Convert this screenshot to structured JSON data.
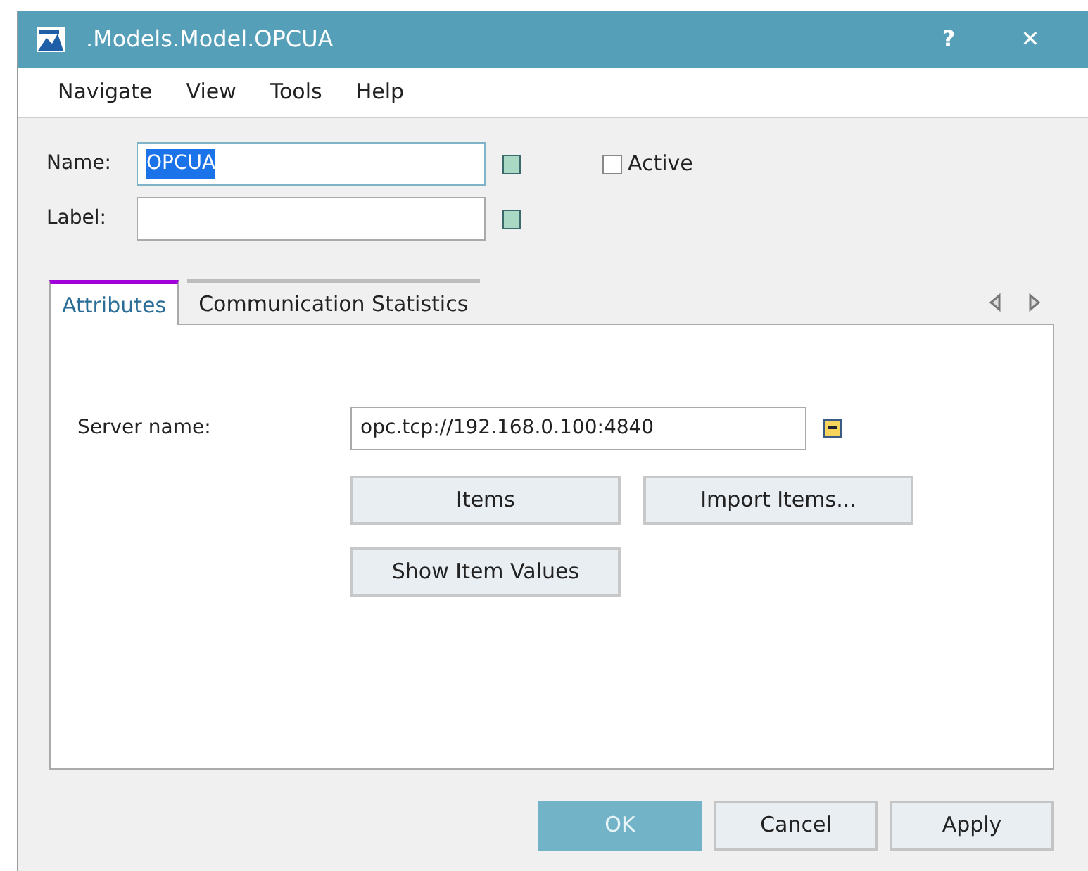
{
  "window": {
    "title": ".Models.Model.OPCUA",
    "controls": [
      "?",
      "✕"
    ]
  },
  "menu": [
    "Navigate",
    "View",
    "Tools",
    "Help"
  ],
  "fields": [
    {
      "label": "Name:",
      "value": "OPCUA",
      "text_selected": true
    },
    {
      "label": "Label:",
      "text_selected": false
    }
  ],
  "active": {
    "label": "Active",
    "checked": false
  },
  "tabs": [
    {
      "label": "Attributes",
      "selected": true
    },
    {
      "label": "Communication Statistics",
      "selected": false
    }
  ],
  "server": {
    "label": "Server name:",
    "value": "opc.tcp://192.168.0.100:4840"
  },
  "panel_buttons": [
    [
      "Items",
      "Import Items..."
    ],
    [
      "Show Item Values"
    ]
  ],
  "footer_buttons": [
    {
      "label": "OK",
      "default": true
    },
    {
      "label": "Cancel",
      "default": false
    },
    {
      "label": "Apply",
      "default": false
    }
  ]
}
